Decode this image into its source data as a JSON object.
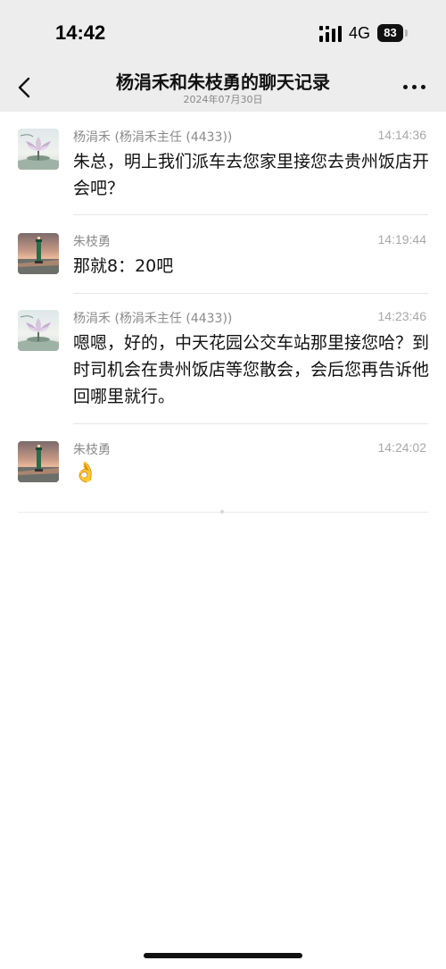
{
  "status_bar": {
    "time": "14:42",
    "network": "4G",
    "battery": "83"
  },
  "header": {
    "title": "杨涓禾和朱枝勇的聊天记录",
    "date": "2024年07月30日"
  },
  "messages": [
    {
      "sender": "杨涓禾 (杨涓禾主任 (4433))",
      "time": "14:14:36",
      "text": "朱总，明上我们派车去您家里接您去贵州饭店开会吧？",
      "avatar": "lotus-avatar"
    },
    {
      "sender": "朱枝勇",
      "time": "14:19:44",
      "text": "那就8：20吧",
      "avatar": "lighthouse-avatar"
    },
    {
      "sender": "杨涓禾 (杨涓禾主任 (4433))",
      "time": "14:23:46",
      "text": "嗯嗯，好的，中天花园公交车站那里接您哈？到时司机会在贵州饭店等您散会，会后您再告诉他回哪里就行。",
      "avatar": "lotus-avatar"
    },
    {
      "sender": "朱枝勇",
      "time": "14:24:02",
      "text": "👌",
      "avatar": "lighthouse-avatar"
    }
  ]
}
